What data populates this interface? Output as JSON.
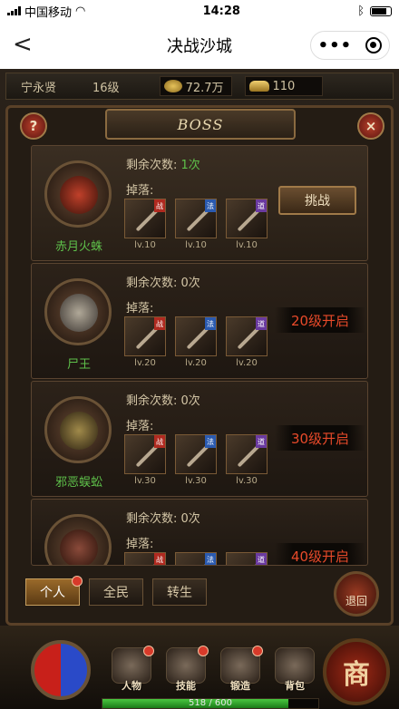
{
  "status": {
    "carrier": "中国移动",
    "time": "14:28"
  },
  "nav": {
    "back": "<",
    "title": "决战沙城"
  },
  "player": {
    "name": "宁永贤",
    "level": "16级",
    "gold": "72.7万",
    "ingot": "110"
  },
  "banner": {
    "title": "BOSS"
  },
  "buttons": {
    "help": "?",
    "close": "×",
    "challenge": "挑战",
    "back": "退回"
  },
  "labels": {
    "remaining": "剩余次数:",
    "drop": "掉落:"
  },
  "bosses": [
    {
      "name": "赤月火蛛",
      "remaining": "1次",
      "items": [
        {
          "tag": "战",
          "lv": "lv.10"
        },
        {
          "tag": "法",
          "lv": "lv.10"
        },
        {
          "tag": "道",
          "lv": "lv.10"
        }
      ]
    },
    {
      "name": "尸王",
      "remaining": "0次",
      "unlock": "20级开启",
      "items": [
        {
          "tag": "战",
          "lv": "lv.20"
        },
        {
          "tag": "法",
          "lv": "lv.20"
        },
        {
          "tag": "道",
          "lv": "lv.20"
        }
      ]
    },
    {
      "name": "邪恶蜈蚣",
      "remaining": "0次",
      "unlock": "30级开启",
      "items": [
        {
          "tag": "战",
          "lv": "lv.30"
        },
        {
          "tag": "法",
          "lv": "lv.30"
        },
        {
          "tag": "道",
          "lv": "lv.30"
        }
      ]
    },
    {
      "name": "",
      "remaining": "0次",
      "unlock": "40级开启",
      "items": [
        {
          "tag": "战",
          "lv": ""
        },
        {
          "tag": "法",
          "lv": ""
        },
        {
          "tag": "道",
          "lv": ""
        }
      ]
    }
  ],
  "tabs": [
    "个人",
    "全民",
    "转生"
  ],
  "menu": [
    {
      "label": "人物"
    },
    {
      "label": "技能"
    },
    {
      "label": "锻造"
    },
    {
      "label": "背包"
    }
  ],
  "shop": "商",
  "exp": {
    "text": "518 / 600",
    "fraction": 0.86
  },
  "colors": {
    "green": "#5ec04a",
    "red": "#e84a2a",
    "gold": "#e6c25a"
  }
}
